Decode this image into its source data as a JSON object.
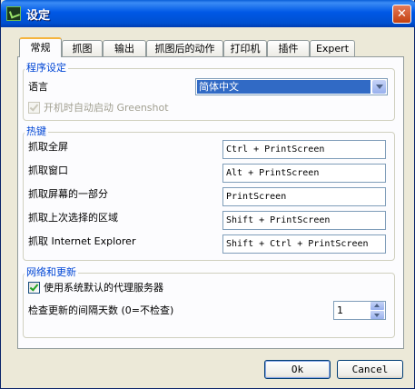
{
  "window": {
    "title": "设定",
    "close_glyph": "✕"
  },
  "tabs": [
    {
      "label": "常规",
      "active": true
    },
    {
      "label": "抓图"
    },
    {
      "label": "输出"
    },
    {
      "label": "抓图后的动作"
    },
    {
      "label": "打印机"
    },
    {
      "label": "插件"
    },
    {
      "label": "Expert"
    }
  ],
  "program_settings": {
    "title": "程序设定",
    "language_label": "语言",
    "language_value": "简体中文",
    "autostart_label": "开机时自动启动 Greenshot",
    "autostart_checked": true,
    "autostart_enabled": false
  },
  "hotkeys": {
    "title": "热键",
    "rows": [
      {
        "label": "抓取全屏",
        "value": "Ctrl + PrintScreen"
      },
      {
        "label": "抓取窗口",
        "value": "Alt + PrintScreen"
      },
      {
        "label": "抓取屏幕的一部分",
        "value": "PrintScreen"
      },
      {
        "label": "抓取上次选择的区域",
        "value": "Shift + PrintScreen"
      },
      {
        "label": "抓取 Internet Explorer",
        "value": "Shift + Ctrl + PrintScreen"
      }
    ]
  },
  "network": {
    "title": "网络和更新",
    "proxy_label": "使用系统默认的代理服务器",
    "proxy_checked": true,
    "update_interval_label": "检查更新的间隔天数 (0=不检查)",
    "update_interval_value": "1"
  },
  "buttons": {
    "ok": "Ok",
    "cancel": "Cancel"
  }
}
